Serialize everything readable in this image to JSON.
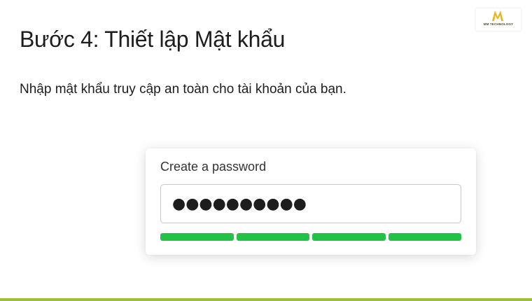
{
  "page": {
    "title": "Bước 4: Thiết lập Mật khẩu",
    "subtitle": "Nhập mật khẩu truy cập an toàn cho tài khoản của bạn."
  },
  "logo": {
    "text": "MM TECHNOLOGY",
    "color": "#e8b61e"
  },
  "form": {
    "label": "Create a password",
    "password_value": "●●●●●●●●●●",
    "strength": {
      "segments_total": 4,
      "segments_filled": 4,
      "color": "#22c247"
    }
  },
  "colors": {
    "bottom_line": "#9cbf3a"
  }
}
